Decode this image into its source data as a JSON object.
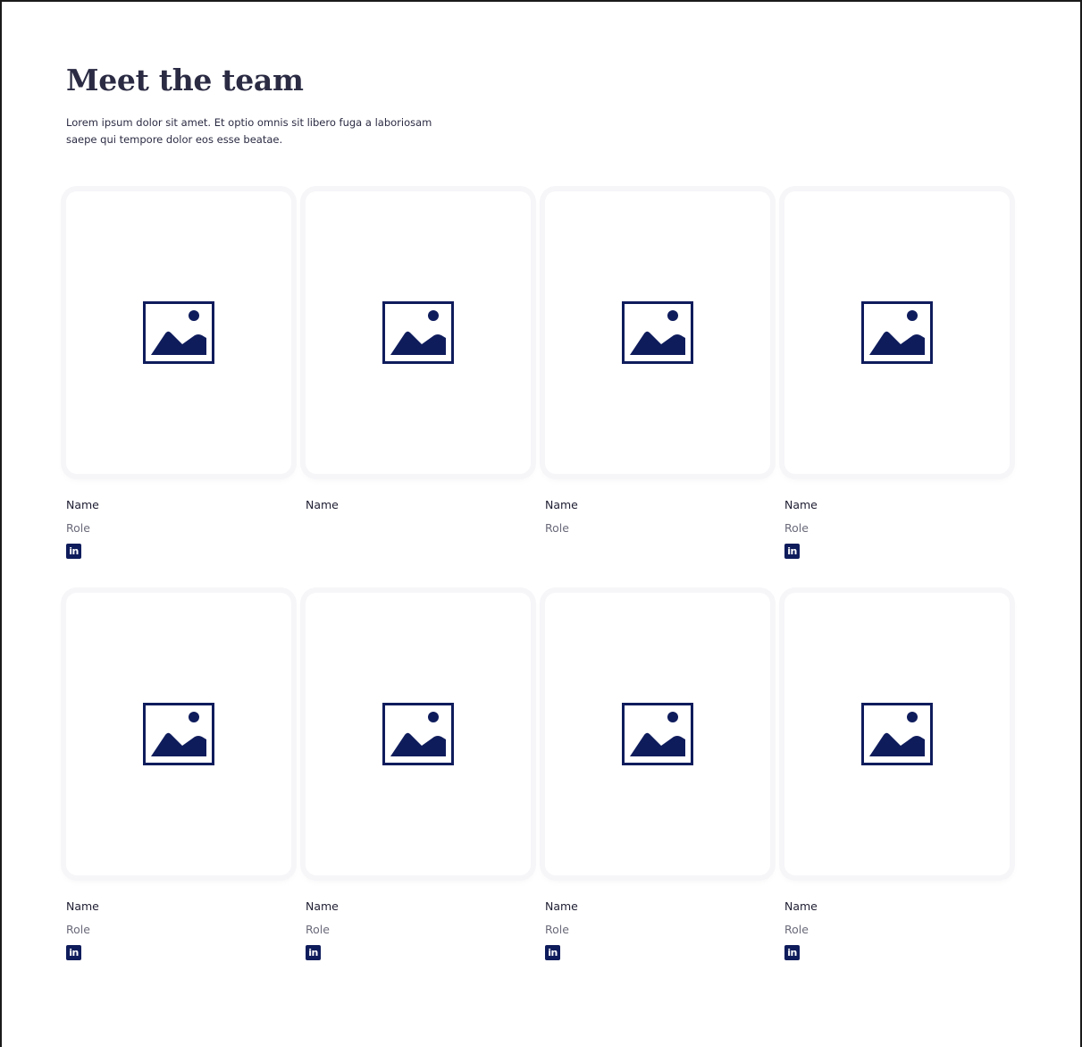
{
  "header": {
    "title": "Meet the team",
    "subtitle": "Lorem ipsum dolor sit amet. Et optio omnis sit libero fuga a laboriosam saepe qui tempore dolor eos esse beatae."
  },
  "colors": {
    "accent": "#0f1c5c",
    "heading": "#2b2b44",
    "muted_text": "#6a6a7a",
    "card_outline": "#f6f6f9"
  },
  "icons": {
    "photo_placeholder": "image-placeholder-icon",
    "social": "linkedin-icon",
    "linkedin_glyph": "in"
  },
  "members": [
    {
      "name": "Name",
      "role": "Role",
      "has_linkedin": true
    },
    {
      "name": "Name",
      "role": "",
      "has_linkedin": false
    },
    {
      "name": "Name",
      "role": "Role",
      "has_linkedin": false
    },
    {
      "name": "Name",
      "role": "Role",
      "has_linkedin": true
    },
    {
      "name": "Name",
      "role": "Role",
      "has_linkedin": true
    },
    {
      "name": "Name",
      "role": "Role",
      "has_linkedin": true
    },
    {
      "name": "Name",
      "role": "Role",
      "has_linkedin": true
    },
    {
      "name": "Name",
      "role": "Role",
      "has_linkedin": true
    }
  ]
}
